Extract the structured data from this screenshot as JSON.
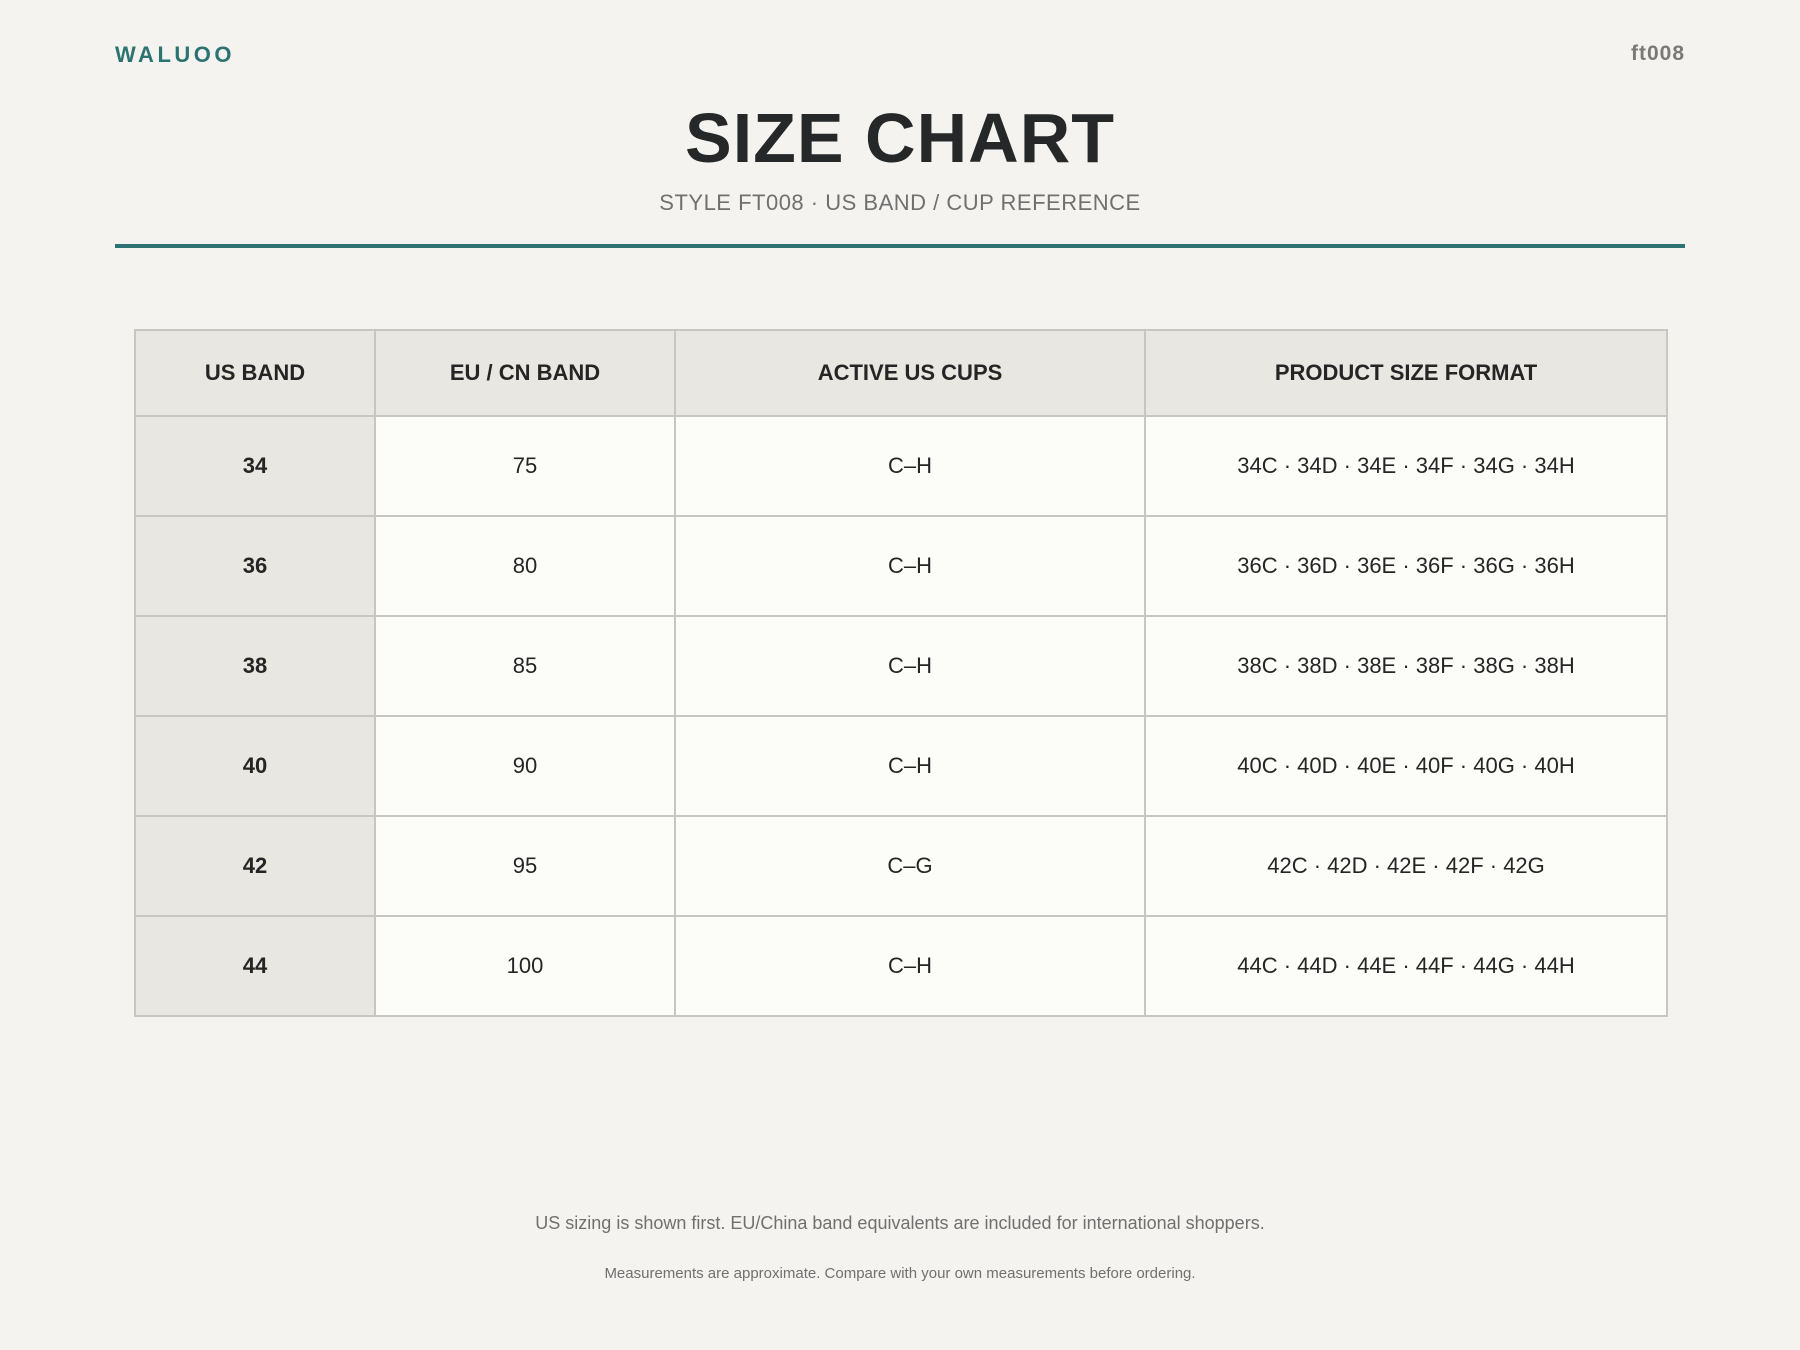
{
  "header": {
    "brand": "WALUOO",
    "code": "ft008",
    "title": "SIZE CHART",
    "subtitle": "STYLE FT008 · US BAND / CUP REFERENCE"
  },
  "colors": {
    "accent": "#2d7371",
    "background": "#f4f3ef",
    "header_cell": "#e9e7e1",
    "body_cell": "#fcfcf9"
  },
  "table": {
    "columns": [
      "US BAND",
      "EU / CN BAND",
      "ACTIVE US CUPS",
      "PRODUCT SIZE FORMAT"
    ],
    "rows": [
      {
        "us_band": "34",
        "eu_band": "75",
        "cups": "C–H",
        "sizes": "34C · 34D · 34E · 34F · 34G · 34H"
      },
      {
        "us_band": "36",
        "eu_band": "80",
        "cups": "C–H",
        "sizes": "36C · 36D · 36E · 36F · 36G · 36H"
      },
      {
        "us_band": "38",
        "eu_band": "85",
        "cups": "C–H",
        "sizes": "38C · 38D · 38E · 38F · 38G · 38H"
      },
      {
        "us_band": "40",
        "eu_band": "90",
        "cups": "C–H",
        "sizes": "40C · 40D · 40E · 40F · 40G · 40H"
      },
      {
        "us_band": "42",
        "eu_band": "95",
        "cups": "C–G",
        "sizes": "42C · 42D · 42E · 42F · 42G"
      },
      {
        "us_band": "44",
        "eu_band": "100",
        "cups": "C–H",
        "sizes": "44C · 44D · 44E · 44F · 44G · 44H"
      }
    ]
  },
  "footer": {
    "note1": "US sizing is shown first. EU/China band equivalents are included for international shoppers.",
    "note2": "Measurements are approximate. Compare with your own measurements before ordering."
  }
}
